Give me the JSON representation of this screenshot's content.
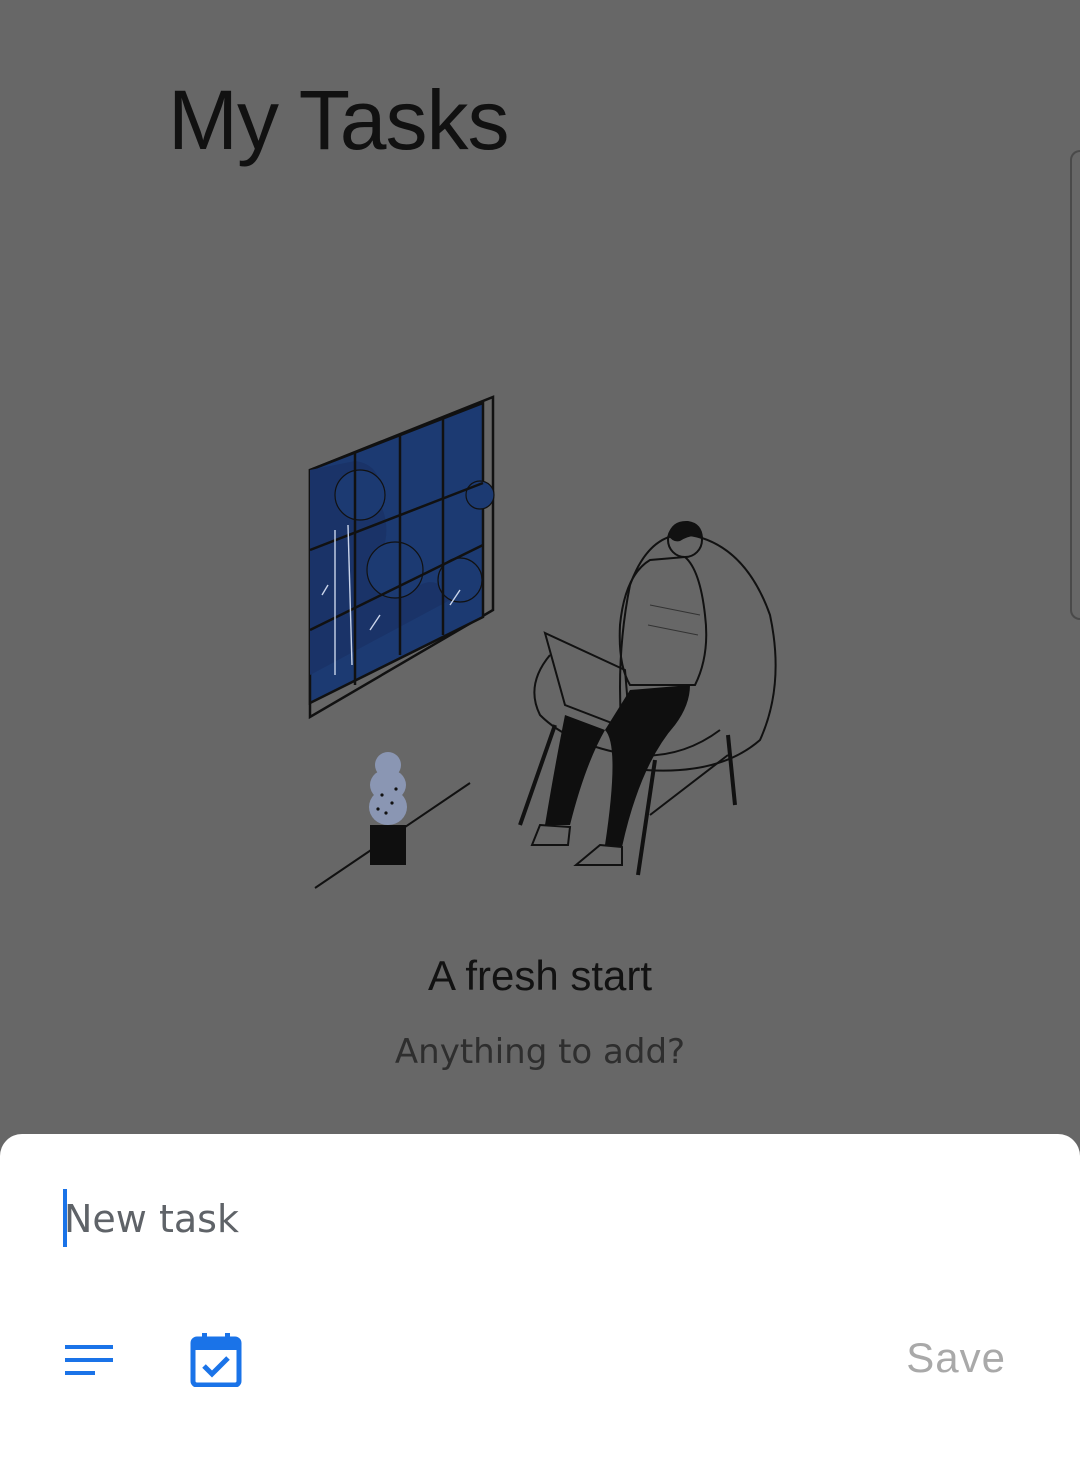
{
  "page": {
    "title": "My Tasks"
  },
  "empty_state": {
    "title": "A fresh start",
    "subtitle": "Anything to add?"
  },
  "new_task_sheet": {
    "input_value": "",
    "input_placeholder": "New task",
    "details_icon": "details-lines-icon",
    "date_icon": "calendar-check-icon",
    "save_label": "Save"
  },
  "colors": {
    "accent": "#1a73e8",
    "scrim": "#676767",
    "save_disabled": "#a9a9a9"
  }
}
